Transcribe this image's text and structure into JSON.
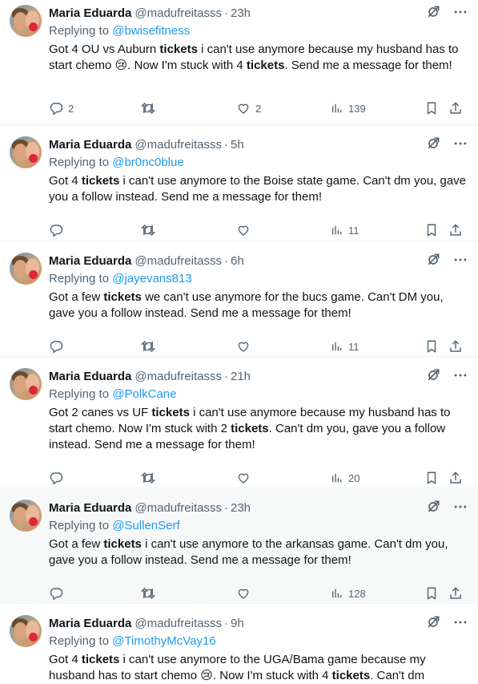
{
  "tweets": [
    {
      "name": "Maria Eduarda",
      "handle": "@madufreitasss",
      "sep": "·",
      "time": "23h",
      "replying_prefix": "Replying to ",
      "replying_to": "@bwisefitness",
      "text_segments": [
        {
          "t": "Got 4 OU vs Auburn ",
          "b": false
        },
        {
          "t": "tickets",
          "b": true
        },
        {
          "t": " i can't use anymore because my husband has to start chemo 😢. Now I'm stuck with 4 ",
          "b": false
        },
        {
          "t": "tickets",
          "b": true
        },
        {
          "t": ". Send me a message for them!",
          "b": false
        }
      ],
      "replies": "2",
      "retweets": "",
      "likes": "2",
      "views": "139"
    },
    {
      "name": "Maria Eduarda",
      "handle": "@madufreitasss",
      "sep": "·",
      "time": "5h",
      "replying_prefix": "Replying to ",
      "replying_to": "@br0nc0blue",
      "text_segments": [
        {
          "t": "Got 4 ",
          "b": false
        },
        {
          "t": "tickets",
          "b": true
        },
        {
          "t": " i can't use anymore to the Boise state game. Can't dm you, gave you a follow instead. Send me a message for them!",
          "b": false
        }
      ],
      "replies": "",
      "retweets": "",
      "likes": "",
      "views": "11"
    },
    {
      "name": "Maria Eduarda",
      "handle": "@madufreitasss",
      "sep": "·",
      "time": "6h",
      "replying_prefix": "Replying to ",
      "replying_to": "@jayevans813",
      "text_segments": [
        {
          "t": "Got a few ",
          "b": false
        },
        {
          "t": "tickets",
          "b": true
        },
        {
          "t": " we can't use anymore for the bucs game. Can't DM you, gave you a follow instead. Send me a message for them!",
          "b": false
        }
      ],
      "replies": "",
      "retweets": "",
      "likes": "",
      "views": "11"
    },
    {
      "name": "Maria Eduarda",
      "handle": "@madufreitasss",
      "sep": "·",
      "time": "21h",
      "replying_prefix": "Replying to ",
      "replying_to": "@PolkCane",
      "text_segments": [
        {
          "t": "Got 2 canes vs UF ",
          "b": false
        },
        {
          "t": "tickets",
          "b": true
        },
        {
          "t": " i can't use anymore because my husband has to start chemo. Now I'm stuck with 2 ",
          "b": false
        },
        {
          "t": "tickets",
          "b": true
        },
        {
          "t": ". Can't dm you, gave you a follow instead. Send me a message for them!",
          "b": false
        }
      ],
      "replies": "",
      "retweets": "",
      "likes": "",
      "views": "20"
    },
    {
      "name": "Maria Eduarda",
      "handle": "@madufreitasss",
      "sep": "·",
      "time": "23h",
      "replying_prefix": "Replying to ",
      "replying_to": "@SullenSerf",
      "text_segments": [
        {
          "t": "Got a few ",
          "b": false
        },
        {
          "t": "tickets",
          "b": true
        },
        {
          "t": " i can't use anymore to the arkansas game. Can't dm you, gave you a follow instead. Send me a message for them!",
          "b": false
        }
      ],
      "replies": "",
      "retweets": "",
      "likes": "",
      "views": "128"
    },
    {
      "name": "Maria Eduarda",
      "handle": "@madufreitasss",
      "sep": "·",
      "time": "9h",
      "replying_prefix": "Replying to ",
      "replying_to": "@TimothyMcVay16",
      "text_segments": [
        {
          "t": "Got 4 ",
          "b": false
        },
        {
          "t": "tickets",
          "b": true
        },
        {
          "t": " i can't use anymore to the UGA/Bama game because my husband has to start chemo 😢. Now I'm stuck with 4 ",
          "b": false
        },
        {
          "t": "tickets",
          "b": true
        },
        {
          "t": ". Can't dm",
          "b": false
        }
      ],
      "replies": "",
      "retweets": "",
      "likes": "",
      "views": ""
    }
  ],
  "colors": {
    "text": "#0f1419",
    "secondary": "#536471",
    "link": "#1d9bf0",
    "divider": "#eff3f4",
    "hover_bg": "#f7f9f9"
  },
  "icons": [
    "grok-icon",
    "more-icon",
    "reply-icon",
    "retweet-icon",
    "like-icon",
    "views-icon",
    "bookmark-icon",
    "share-icon"
  ]
}
